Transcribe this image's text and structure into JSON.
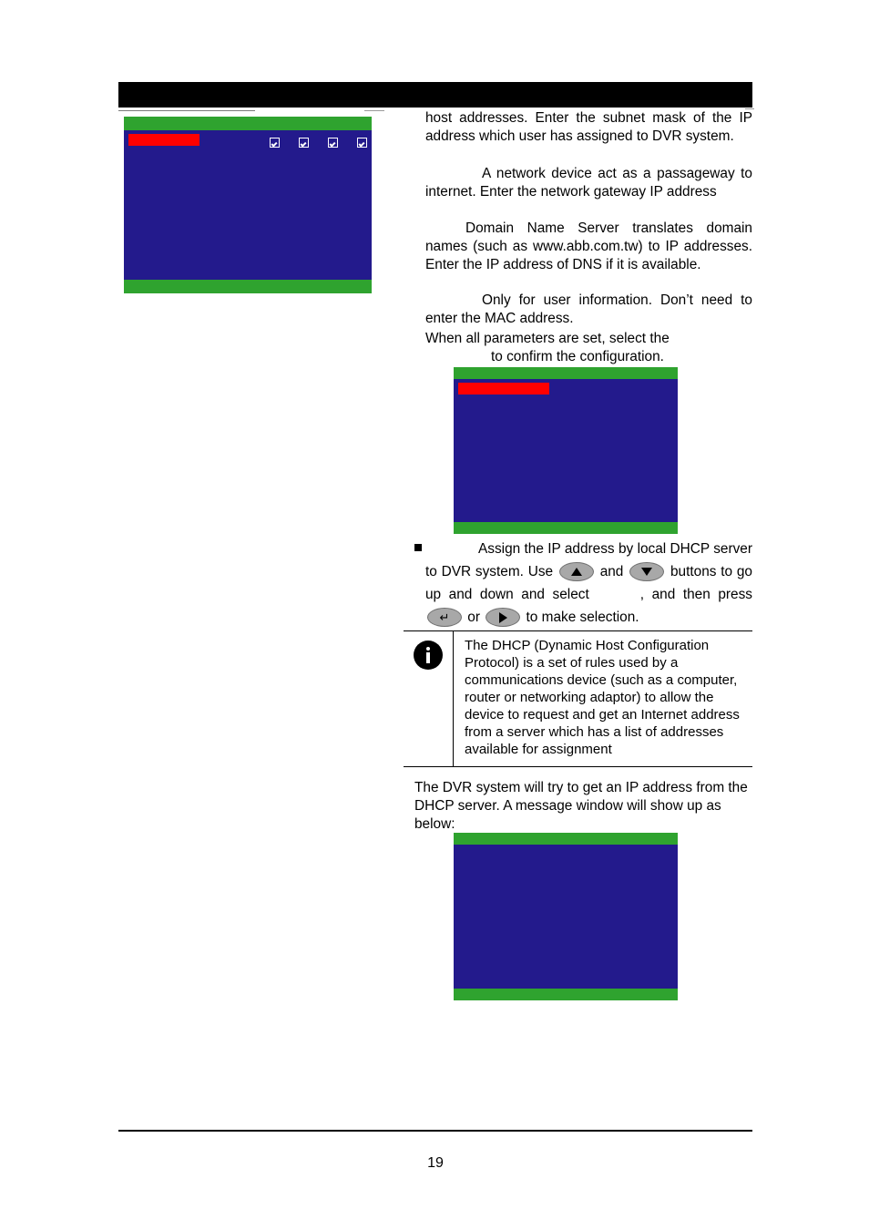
{
  "document": {
    "page_number": "19"
  },
  "header": {
    "band_text": ""
  },
  "colors": {
    "osd_background": "#231a8c",
    "osd_bar": "#2fa32f",
    "osd_highlight": "#ff0000",
    "key_button": "#a8a8a8",
    "info_icon": "#000000"
  },
  "screenshots": {
    "network_page_2": {
      "name": "network-setup-osd",
      "title_highlight": "",
      "checkbox_count": 4,
      "checkboxes": [
        {
          "label": "",
          "checked": true
        },
        {
          "label": "",
          "checked": true
        },
        {
          "label": "",
          "checked": true
        },
        {
          "label": "",
          "checked": true
        }
      ]
    },
    "network_apply": {
      "name": "network-apply-osd",
      "title_highlight": ""
    },
    "dhcp_message": {
      "name": "dhcp-message-osd",
      "title_highlight": ""
    }
  },
  "body": {
    "subnet_paragraph": "host addresses. Enter the subnet mask of the IP address which user has assigned to DVR system.",
    "gateway_paragraph": "A network device act as a passageway to internet. Enter the network gateway IP address",
    "dns_paragraph": "Domain Name Server translates domain names (such as www.abb.com.tw) to IP addresses. Enter the IP address of DNS if it is available.",
    "mac_paragraph": "Only for user information. Don’t need to enter the MAC address.",
    "confirm_line_1": "When all parameters are set, select the",
    "confirm_line_2": "to confirm the configuration.",
    "dhcp_bullet": {
      "lead_in": "Assign the IP address by local DHCP server to DVR system. Use",
      "and_word": "and",
      "mid": "buttons to go up and down and select",
      "after_select": ", and",
      "then_press": "then press",
      "or_word": "or",
      "tail": "to make selection."
    },
    "dhcp_result_paragraph": "The DVR system will try to get an IP address from the DHCP server. A message window will show up as below:"
  },
  "info_note": {
    "icon": "info-icon",
    "text": "The DHCP (Dynamic Host Configuration Protocol) is a set of rules used by a communications device (such as a computer, router or networking adaptor) to allow the device to request and get an Internet address from a server which has a list of addresses available for assignment"
  },
  "keys": {
    "up": "up-arrow-key",
    "down": "down-arrow-key",
    "enter": "enter-key",
    "right": "right-arrow-key",
    "enter_glyph": "↵"
  }
}
